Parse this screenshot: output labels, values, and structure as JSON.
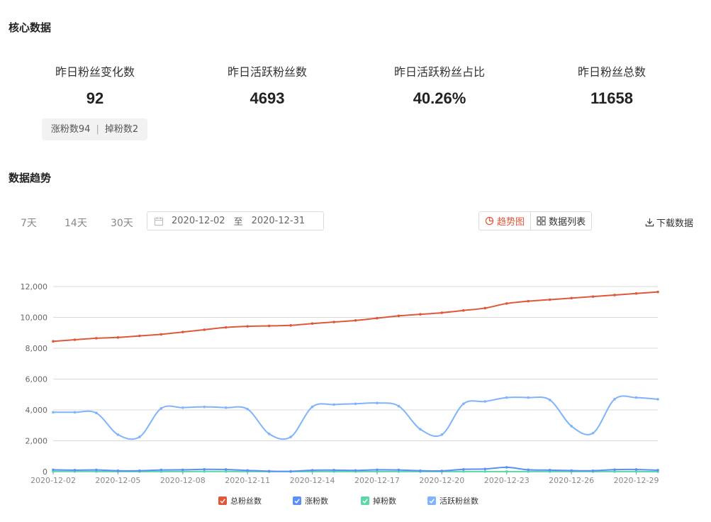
{
  "sections": {
    "core": "核心数据",
    "trend": "数据趋势"
  },
  "kpis": [
    {
      "label": "昨日粉丝变化数",
      "value": "92"
    },
    {
      "label": "昨日活跃粉丝数",
      "value": "4693"
    },
    {
      "label": "昨日活跃粉丝占比",
      "value": "40.26%"
    },
    {
      "label": "昨日粉丝总数",
      "value": "11658"
    }
  ],
  "tooltip": {
    "gain": "涨粉数94",
    "sep": "|",
    "loss": "掉粉数2"
  },
  "range_buttons": [
    "7天",
    "14天",
    "30天"
  ],
  "date_range": {
    "start": "2020-12-02",
    "separator": "至",
    "end": "2020-12-31"
  },
  "view_toggle": {
    "trend": "趋势图",
    "table": "数据列表"
  },
  "download": "下载数据",
  "icons": {
    "calendar": "calendar-icon",
    "pie": "pie-chart-icon",
    "grid": "grid-icon",
    "download": "download-icon"
  },
  "colors": {
    "accent": "#e0573a",
    "total": "#e0573a",
    "gain": "#5b8ff9",
    "loss": "#5ad8a6",
    "active": "#7fb3ff"
  },
  "chart_data": {
    "type": "line",
    "ylim": [
      0,
      12000
    ],
    "yticks": [
      0,
      2000,
      4000,
      6000,
      8000,
      10000,
      12000
    ],
    "ytick_labels": [
      "0",
      "2,000",
      "4,000",
      "6,000",
      "8,000",
      "10,000",
      "12,000"
    ],
    "x": [
      "2020-12-02",
      "2020-12-03",
      "2020-12-04",
      "2020-12-05",
      "2020-12-06",
      "2020-12-07",
      "2020-12-08",
      "2020-12-09",
      "2020-12-10",
      "2020-12-11",
      "2020-12-12",
      "2020-12-13",
      "2020-12-14",
      "2020-12-15",
      "2020-12-16",
      "2020-12-17",
      "2020-12-18",
      "2020-12-19",
      "2020-12-20",
      "2020-12-21",
      "2020-12-22",
      "2020-12-23",
      "2020-12-24",
      "2020-12-25",
      "2020-12-26",
      "2020-12-27",
      "2020-12-28",
      "2020-12-29",
      "2020-12-30"
    ],
    "xtick_labels": [
      "2020-12-02",
      "2020-12-05",
      "2020-12-08",
      "2020-12-11",
      "2020-12-14",
      "2020-12-17",
      "2020-12-20",
      "2020-12-23",
      "2020-12-26",
      "2020-12-29"
    ],
    "xtick_every": 3,
    "series": [
      {
        "name": "总粉丝数",
        "color": "#e0573a",
        "values": [
          8450,
          8550,
          8650,
          8700,
          8800,
          8900,
          9050,
          9200,
          9350,
          9420,
          9450,
          9480,
          9600,
          9700,
          9800,
          9950,
          10100,
          10200,
          10300,
          10450,
          10600,
          10900,
          11050,
          11150,
          11250,
          11350,
          11450,
          11550,
          11650
        ]
      },
      {
        "name": "涨粉数",
        "color": "#5b8ff9",
        "values": [
          120,
          100,
          110,
          60,
          60,
          110,
          120,
          150,
          140,
          80,
          30,
          20,
          90,
          100,
          80,
          120,
          110,
          60,
          50,
          150,
          170,
          280,
          120,
          100,
          70,
          60,
          130,
          140,
          94
        ]
      },
      {
        "name": "掉粉数",
        "color": "#5ad8a6",
        "values": [
          10,
          10,
          8,
          5,
          5,
          6,
          8,
          10,
          9,
          6,
          4,
          3,
          5,
          6,
          5,
          7,
          6,
          4,
          3,
          6,
          5,
          8,
          5,
          4,
          3,
          3,
          4,
          3,
          2
        ]
      },
      {
        "name": "活跃粉丝数",
        "color": "#7fb3ff",
        "values": [
          3850,
          3850,
          3800,
          2400,
          2250,
          4100,
          4150,
          4200,
          4150,
          4050,
          2450,
          2250,
          4200,
          4350,
          4400,
          4450,
          4250,
          2750,
          2400,
          4400,
          4550,
          4800,
          4800,
          4650,
          2950,
          2500,
          4700,
          4800,
          4693
        ]
      }
    ],
    "legend": [
      "总粉丝数",
      "涨粉数",
      "掉粉数",
      "活跃粉丝数"
    ],
    "legend_position": "bottom",
    "grid": true
  }
}
